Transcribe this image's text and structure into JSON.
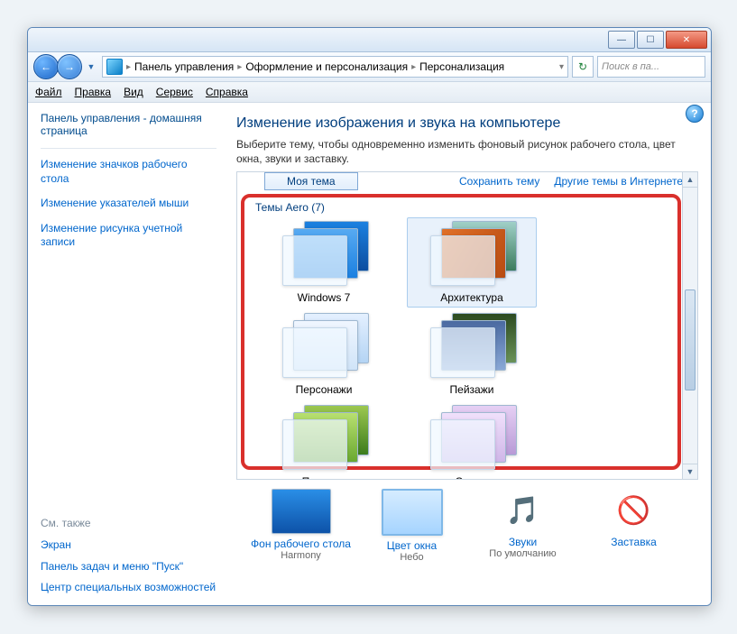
{
  "titlebar": {
    "min": "—",
    "max": "☐",
    "close": "✕"
  },
  "nav": {
    "back": "←",
    "fwd": "→",
    "crumbs": [
      "Панель управления",
      "Оформление и персонализация",
      "Персонализация"
    ],
    "search_placeholder": "Поиск в па..."
  },
  "menu": {
    "file": "Файл",
    "edit": "Правка",
    "view": "Вид",
    "tools": "Сервис",
    "help": "Справка"
  },
  "sidebar": {
    "home": "Панель управления - домашняя страница",
    "links": [
      "Изменение значков рабочего стола",
      "Изменение указателей мыши",
      "Изменение рисунка учетной записи"
    ],
    "seealso_hdr": "См. также",
    "seealso": [
      "Экран",
      "Панель задач и меню \"Пуск\"",
      "Центр специальных возможностей"
    ]
  },
  "main": {
    "heading": "Изменение изображения и звука на компьютере",
    "desc": "Выберите тему, чтобы одновременно изменить фоновый рисунок рабочего стола, цвет окна, звуки и заставку.",
    "my_theme": "Моя тема",
    "save_theme": "Сохранить тему",
    "other_themes": "Другие темы в Интернете",
    "group_title": "Темы Aero (7)",
    "themes": [
      {
        "label": "Windows 7",
        "cls1": "g-win7",
        "cls2": "g-win7b",
        "sel": false
      },
      {
        "label": "Архитектура",
        "cls1": "g-arch1",
        "cls2": "g-arch2",
        "sel": true
      },
      {
        "label": "Персонажи",
        "cls1": "g-char1",
        "cls2": "g-char2",
        "sel": false
      },
      {
        "label": "Пейзажи",
        "cls1": "g-land1",
        "cls2": "g-land2",
        "sel": false
      },
      {
        "label": "Природа",
        "cls1": "g-nat1",
        "cls2": "g-nat2",
        "sel": false
      },
      {
        "label": "Сцены",
        "cls1": "g-scn1",
        "cls2": "g-scn2",
        "sel": false
      }
    ]
  },
  "bottom": [
    {
      "label": "Фон рабочего стола",
      "value": "Harmony",
      "icon": "g-desktop"
    },
    {
      "label": "Цвет окна",
      "value": "Небо",
      "icon": "g-color"
    },
    {
      "label": "Звуки",
      "value": "По умолчанию",
      "icon": "sound",
      "glyph": "🎵"
    },
    {
      "label": "Заставка",
      "value": "",
      "icon": "saver",
      "glyph": "🚫"
    }
  ],
  "help_glyph": "?"
}
